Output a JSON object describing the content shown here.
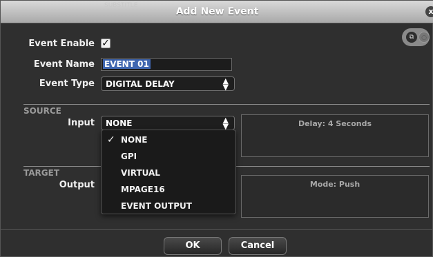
{
  "dialog": {
    "ghost_label": "SUBSTITLE",
    "title": "Add New Event",
    "close_glyph": "x"
  },
  "corner_tools": {
    "copy_glyph": "⧉",
    "other_glyph": "○"
  },
  "form": {
    "enable_label": "Event Enable",
    "enable_checked": true,
    "name_label": "Event Name",
    "name_value": "EVENT 01",
    "type_label": "Event Type",
    "type_value": "DIGITAL DELAY"
  },
  "source": {
    "title": "SOURCE",
    "input_label": "Input",
    "input_value": "NONE",
    "panel_text": "Delay: 4 Seconds"
  },
  "input_options": [
    {
      "label": "NONE",
      "checked": true
    },
    {
      "label": "GPI",
      "checked": false
    },
    {
      "label": "VIRTUAL",
      "checked": false
    },
    {
      "label": "MPAGE16",
      "checked": false
    },
    {
      "label": "EVENT OUTPUT",
      "checked": false
    }
  ],
  "target": {
    "title": "TARGET",
    "output_label": "Output",
    "panel_text": "Mode: Push"
  },
  "buttons": {
    "ok": "OK",
    "cancel": "Cancel"
  },
  "icons": {
    "checkmark": "✓",
    "select_arrows": "⬍"
  }
}
